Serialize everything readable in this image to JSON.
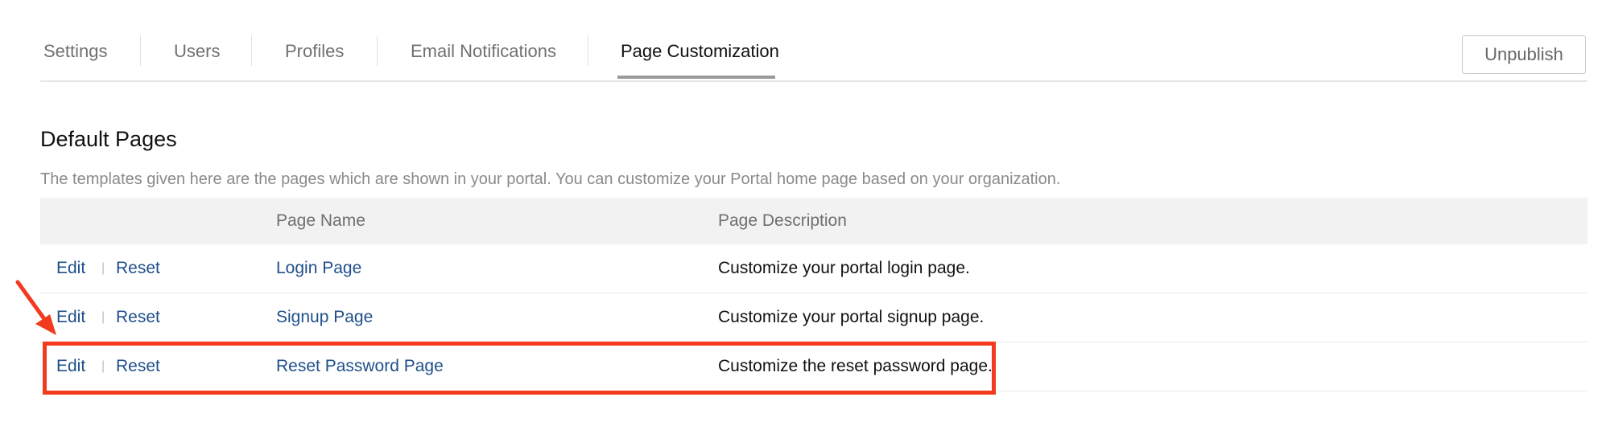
{
  "tabs": [
    {
      "label": "Settings"
    },
    {
      "label": "Users"
    },
    {
      "label": "Profiles"
    },
    {
      "label": "Email Notifications"
    },
    {
      "label": "Page Customization",
      "active": true
    }
  ],
  "actions": {
    "unpublish_label": "Unpublish"
  },
  "section": {
    "title": "Default Pages",
    "description": "The templates given here are the pages which are shown in your portal. You can customize your Portal home page based on your organization."
  },
  "table": {
    "headers": {
      "page_name": "Page Name",
      "page_description": "Page Description"
    },
    "rows": [
      {
        "edit": "Edit",
        "separator": "|",
        "reset": "Reset",
        "name": "Login Page",
        "description": "Customize your portal login page."
      },
      {
        "edit": "Edit",
        "separator": "|",
        "reset": "Reset",
        "name": "Signup Page",
        "description": "Customize your portal signup page."
      },
      {
        "edit": "Edit",
        "separator": "|",
        "reset": "Reset",
        "name": "Reset Password Page",
        "description": "Customize the reset password page."
      }
    ]
  },
  "annotation": {
    "color": "#f23a1e",
    "icon": "arrow-icon"
  }
}
